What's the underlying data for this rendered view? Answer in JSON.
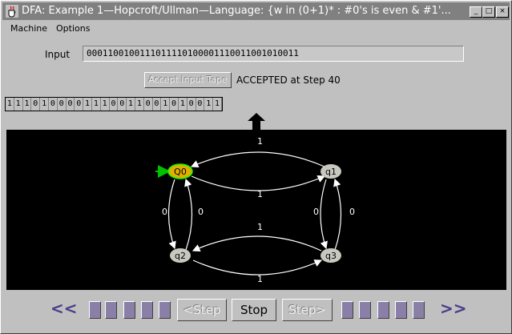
{
  "window": {
    "title": "DFA: Example 1—Hopcroft/Ullman—Language: {w in (0+1)* : #0's is even & #1'...",
    "controls": {
      "minimize": "_",
      "maximize": "□",
      "close": "×"
    }
  },
  "menu": {
    "items": [
      "Machine",
      "Options"
    ]
  },
  "input": {
    "label": "Input",
    "value": "0001100100111011110100001110011001010011"
  },
  "accept_button": {
    "label": "Accept Input Tape"
  },
  "status": "ACCEPTED at Step 40",
  "tape": {
    "cells": [
      "1",
      "1",
      "1",
      "0",
      "1",
      "0",
      "0",
      "0",
      "0",
      "1",
      "1",
      "1",
      "0",
      "0",
      "1",
      "1",
      "0",
      "0",
      "1",
      "0",
      "1",
      "0",
      "0",
      "1",
      "1"
    ]
  },
  "dfa": {
    "states": [
      {
        "id": "q0",
        "label": "Q0",
        "start": true,
        "accepting": true,
        "current": true,
        "fill": "#e0b000"
      },
      {
        "id": "q1",
        "label": "q1",
        "fill": "#c8c8c0"
      },
      {
        "id": "q2",
        "label": "q2",
        "fill": "#c8c8c0"
      },
      {
        "id": "q3",
        "label": "q3",
        "fill": "#c8c8c0"
      }
    ],
    "transition_labels": {
      "q0_q1_top": "1",
      "q0_q1_bottom": "1",
      "q0_q2_left": "0",
      "q0_q2_right": "0",
      "q1_q3_left": "0",
      "q1_q3_right": "0",
      "q2_q3_top": "1",
      "q2_q3_bottom": "1"
    },
    "colors": {
      "edge": "#ffffff",
      "start_arrow": "#00c000",
      "current_outline": "#00ff00",
      "background": "#000000"
    }
  },
  "nav": {
    "rewind": "<<",
    "step_back": "<Step",
    "stop": "Stop",
    "step_forward": "Step>",
    "fast_forward": ">>"
  }
}
